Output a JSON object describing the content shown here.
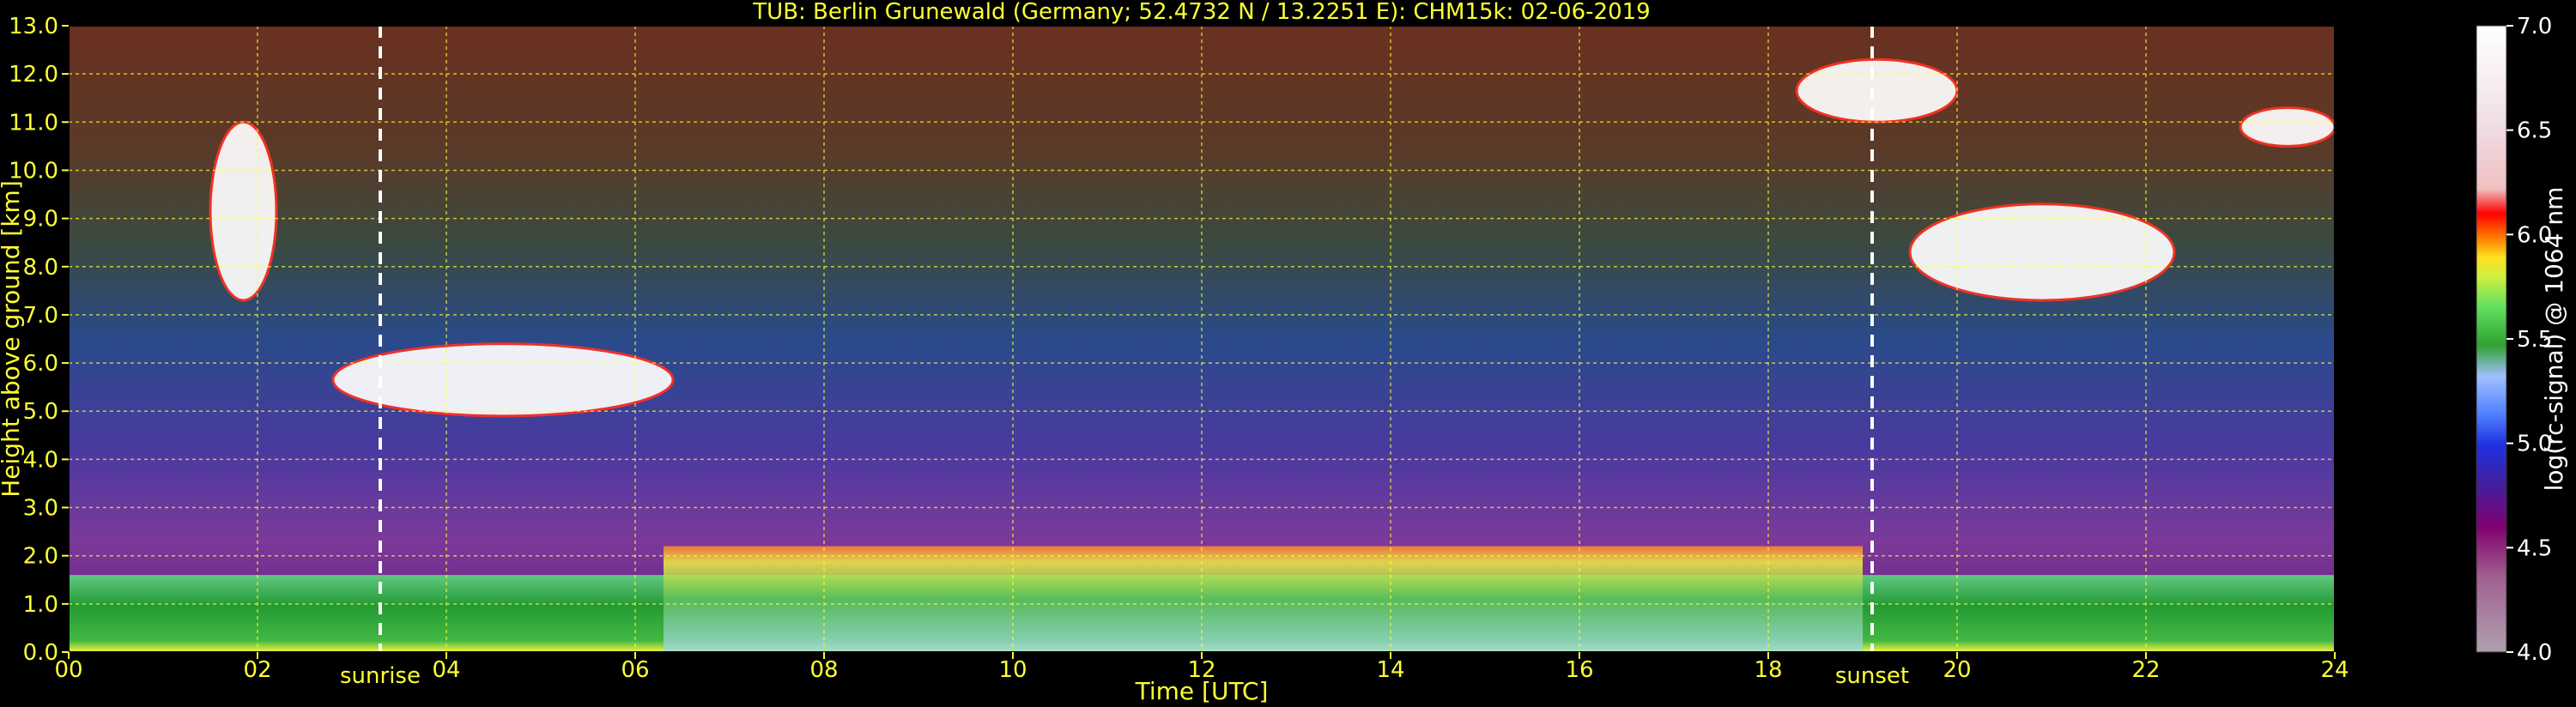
{
  "chart_data": {
    "type": "heatmap",
    "title": "TUB: Berlin Grunewald (Germany; 52.4732 N / 13.2251 E):    CHM15k: 02-06-2019",
    "xlabel": "Time [UTC]",
    "ylabel": "Height above ground [km]",
    "xlim": [
      0,
      24
    ],
    "ylim": [
      0,
      13
    ],
    "x_ticks": [
      "00",
      "02",
      "04",
      "06",
      "08",
      "10",
      "12",
      "14",
      "16",
      "18",
      "20",
      "22",
      "24"
    ],
    "y_ticks": [
      "0.0",
      "1.0",
      "2.0",
      "3.0",
      "4.0",
      "5.0",
      "6.0",
      "7.0",
      "8.0",
      "9.0",
      "10.0",
      "11.0",
      "12.0",
      "13.0"
    ],
    "grid": true,
    "events": [
      {
        "label": "sunrise",
        "time": 3.3
      },
      {
        "label": "sunset",
        "time": 19.1
      }
    ],
    "colorbar": {
      "label": "log(rc-signal) @ 1064 nm",
      "range": [
        4.0,
        7.0
      ],
      "ticks": [
        "4.0",
        "4.5",
        "5.0",
        "5.5",
        "6.0",
        "6.5",
        "7.0"
      ]
    },
    "features": [
      {
        "kind": "boundary_layer",
        "t0": 0,
        "t1": 24,
        "h0": 0,
        "h1": 1.6
      },
      {
        "kind": "boundary_layer",
        "t0": 6.3,
        "t1": 19,
        "h0": 0,
        "h1": 2.2
      },
      {
        "kind": "cloud",
        "t0": 2.8,
        "t1": 6.4,
        "h0": 4.9,
        "h1": 6.4
      },
      {
        "kind": "cloud",
        "t0": 1.5,
        "t1": 2.2,
        "h0": 7.3,
        "h1": 11.0
      },
      {
        "kind": "cloud",
        "t0": 18.3,
        "t1": 20.0,
        "h0": 11.0,
        "h1": 12.3
      },
      {
        "kind": "cloud",
        "t0": 19.5,
        "t1": 22.3,
        "h0": 7.3,
        "h1": 9.3
      },
      {
        "kind": "cloud",
        "t0": 23.0,
        "t1": 24.0,
        "h0": 10.5,
        "h1": 11.3
      }
    ]
  }
}
